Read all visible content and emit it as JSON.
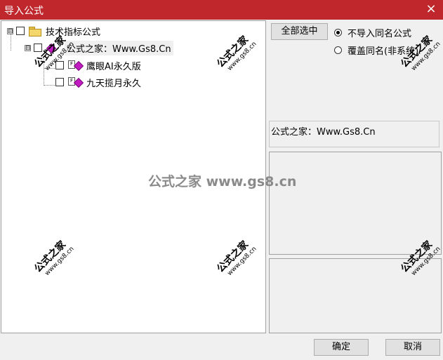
{
  "window": {
    "title": "导入公式",
    "close_glyph": "×"
  },
  "tree": {
    "root": {
      "label": "技术指标公式",
      "expander": "⊟"
    },
    "group": {
      "label": "公式之家：Www.Gs8.Cn",
      "expander": "⊟"
    },
    "items": [
      {
        "label": "鹰眼AI永久版"
      },
      {
        "label": "九天揽月永久"
      }
    ]
  },
  "right": {
    "select_all_label": "全部选中",
    "options": [
      {
        "label": "不导入同名公式",
        "checked": true
      },
      {
        "label": "覆盖同名(非系统)",
        "checked": false
      }
    ],
    "info_text": "公式之家：Www.Gs8.Cn"
  },
  "buttons": {
    "ok_label": "确定",
    "cancel_label": "取消"
  },
  "watermarks": {
    "text": "公式之家",
    "sub": "www.gs8.cn",
    "center": "公式之家 www.gs8.cn"
  }
}
